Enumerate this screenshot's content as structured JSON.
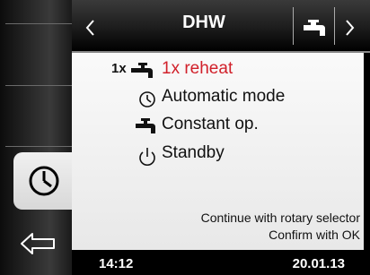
{
  "header": {
    "title": "DHW",
    "prev_icon": "chevron-left-icon",
    "next_icon": "chevron-right-icon",
    "mode_icon": "tap-icon"
  },
  "sidebar": {
    "items": [
      {
        "icon": "clock-icon",
        "selected": true
      },
      {
        "icon": "back-arrow-icon",
        "selected": false
      }
    ]
  },
  "options": [
    {
      "prefix": "1x",
      "icon": "tap-icon",
      "label": "1x reheat",
      "highlighted": true,
      "color": "#d1202a"
    },
    {
      "icon": "clock-icon",
      "label": "Automatic mode"
    },
    {
      "icon": "tap-icon",
      "label": "Constant op."
    },
    {
      "icon": "standby-icon",
      "label": "Standby"
    }
  ],
  "hints": {
    "line1": "Continue with rotary selector",
    "line2": "Confirm with OK"
  },
  "status": {
    "time": "14:12",
    "date": "20.01.13"
  }
}
